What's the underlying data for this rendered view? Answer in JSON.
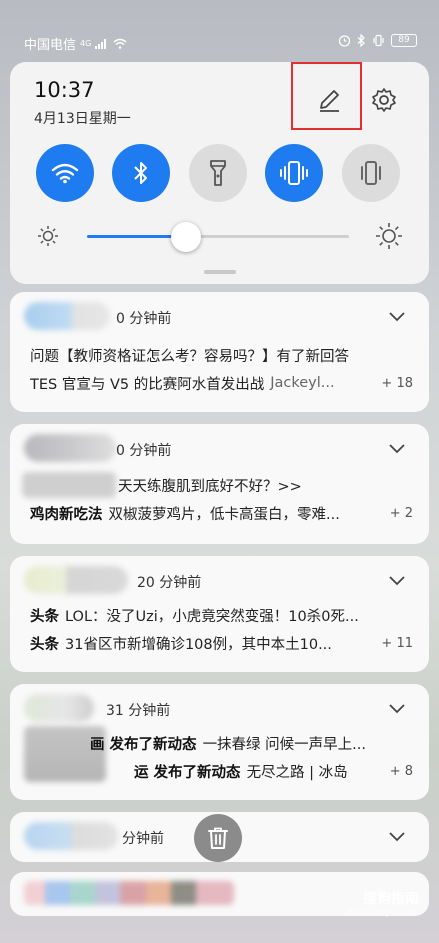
{
  "status": {
    "carrier": "中国电信",
    "signal_label": "4G",
    "battery": "89"
  },
  "panel": {
    "time": "10:37",
    "date": "4月13日星期一",
    "toggles": [
      {
        "name": "wifi",
        "state": "on"
      },
      {
        "name": "bluetooth",
        "state": "on"
      },
      {
        "name": "flashlight",
        "state": "off"
      },
      {
        "name": "vibrate",
        "state": "on"
      },
      {
        "name": "silent",
        "state": "off"
      }
    ],
    "brightness": 0.37
  },
  "notifications": [
    {
      "time_ago": "0 分钟前",
      "lines": [
        {
          "lead": "",
          "body": "问题【教师资格证怎么考？容易吗？】有了新回答",
          "muted": "",
          "count": ""
        },
        {
          "lead": "",
          "body": "TES 官宣与 V5 的比赛阿水首发出战",
          "muted": "Jackeyl...",
          "count": "+ 18"
        }
      ]
    },
    {
      "time_ago": "0 分钟前",
      "lines": [
        {
          "lead": "",
          "body": "天天练腹肌到底好不好？>>",
          "muted": "",
          "count": ""
        },
        {
          "lead": "鸡肉新吃法",
          "body": "双椒菠萝鸡片，低卡高蛋白，零难...",
          "muted": "",
          "count": "+ 2"
        }
      ]
    },
    {
      "time_ago": "20 分钟前",
      "lines": [
        {
          "lead": "头条",
          "body": "LOL：没了Uzi，小虎竟突然变强！10杀0死...",
          "muted": "",
          "count": ""
        },
        {
          "lead": "头条",
          "body": "31省区市新增确诊108例，其中本土10...",
          "muted": "",
          "count": "+ 11"
        }
      ]
    },
    {
      "time_ago": "31 分钟前",
      "lines": [
        {
          "lead": "画 发布了新动态",
          "body": "一抹春绿 问候一声早上...",
          "muted": "",
          "count": ""
        },
        {
          "lead": "运 发布了新动态",
          "body": "无尽之路 | 冰岛",
          "muted": "",
          "count": "+ 8"
        }
      ]
    },
    {
      "time_ago": "分钟前",
      "lines": []
    }
  ],
  "watermark": {
    "title": "搜狗指南",
    "sub": "zhinan.sogou.com"
  },
  "icons": {
    "edit": "pencil-icon",
    "settings": "gear-icon",
    "trash": "trash-icon",
    "chevron": "chevron-down-icon"
  },
  "colors": {
    "accent": "#1f7cf0",
    "highlight_box": "#e03030"
  }
}
